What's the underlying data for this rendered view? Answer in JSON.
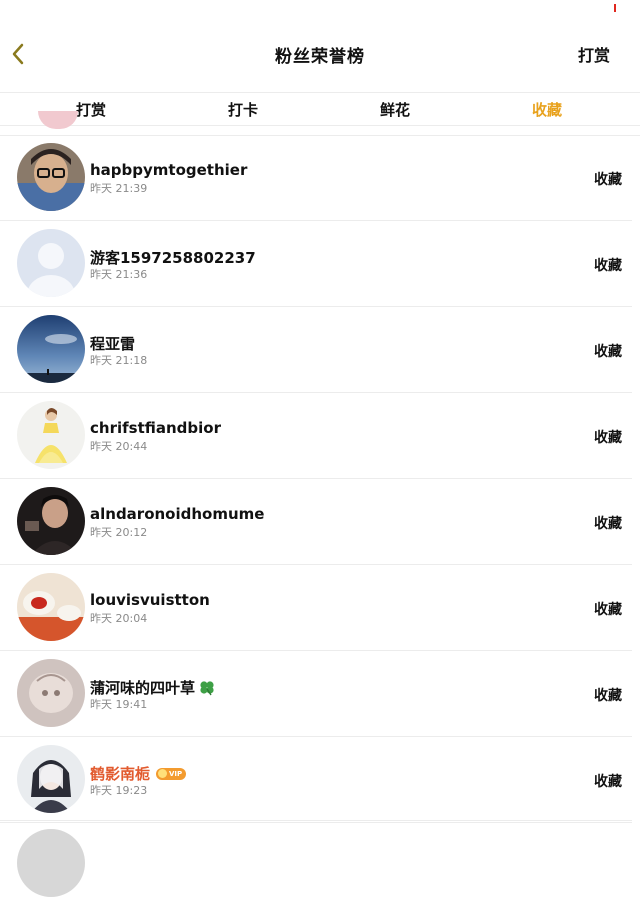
{
  "header": {
    "title": "粉丝荣誉榜",
    "reward_label": "打赏",
    "back_icon": "chevron-left-icon",
    "accent": "#e8a21e"
  },
  "tabs": [
    {
      "label": "打赏",
      "active": false
    },
    {
      "label": "打卡",
      "active": false
    },
    {
      "label": "鲜花",
      "active": false
    },
    {
      "label": "收藏",
      "active": true
    }
  ],
  "fans": [
    {
      "name": "hapbpymtogethier",
      "time": "昨天 21:39",
      "action": "收藏"
    },
    {
      "name": "游客1597258802237",
      "time": "昨天 21:36",
      "action": "收藏"
    },
    {
      "name": "程亚雷",
      "time": "昨天 21:18",
      "action": "收藏"
    },
    {
      "name": "chrifstfiandbior",
      "time": "昨天 20:44",
      "action": "收藏"
    },
    {
      "name": "alndaronoidhomume",
      "time": "昨天 20:12",
      "action": "收藏"
    },
    {
      "name": "louvisvuistton",
      "time": "昨天 20:04",
      "action": "收藏"
    },
    {
      "name": "蒲河味的四叶草",
      "time": "昨天 19:41",
      "action": "收藏",
      "emoji": "clover-icon"
    },
    {
      "name": "鹤影南栀",
      "time": "昨天 19:23",
      "action": "收藏",
      "vip": true,
      "vip_label": "VIP",
      "name_color": "#e25b2f"
    }
  ]
}
